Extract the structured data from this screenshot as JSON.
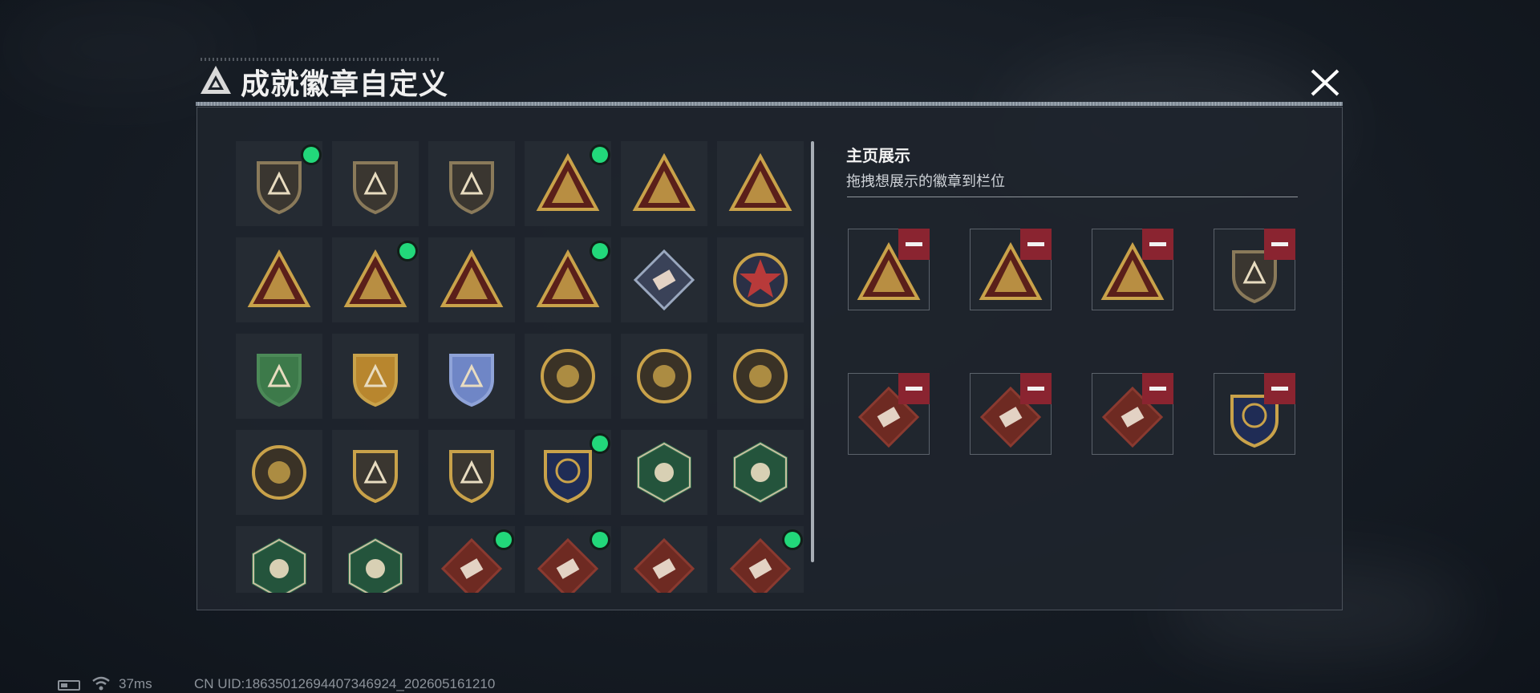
{
  "header": {
    "title": "成就徽章自定义",
    "logo_icon": "triangle-logo-icon",
    "close_icon": "close-icon"
  },
  "grid": {
    "rows": [
      [
        {
          "icon": "shield-triangle-badge-icon",
          "color": "#8a7a5a",
          "equipped": true
        },
        {
          "icon": "shield-helicopter-badge-icon",
          "color": "#8a7a5a",
          "equipped": false
        },
        {
          "icon": "shield-dagger-badge-icon",
          "color": "#8a7a5a",
          "equipped": false
        },
        {
          "icon": "triangle-sign-badge-icon",
          "color": "#c9a24a",
          "equipped": true
        },
        {
          "icon": "triangle-helmet-badge-icon",
          "color": "#c9a24a",
          "equipped": false
        },
        {
          "icon": "triangle-tank-badge-icon",
          "color": "#c9a24a",
          "equipped": false
        }
      ],
      [
        {
          "icon": "triangle-number-badge-icon",
          "color": "#c9a24a",
          "equipped": false
        },
        {
          "icon": "triangle-soldier-badge-icon",
          "color": "#c9a24a",
          "equipped": true
        },
        {
          "icon": "triangle-squad-badge-icon",
          "color": "#c9a24a",
          "equipped": false
        },
        {
          "icon": "triangle-rocket-badge-icon",
          "color": "#c9a24a",
          "equipped": true
        },
        {
          "icon": "diamond-launcher-badge-icon",
          "color": "#9aa8bf",
          "equipped": false
        },
        {
          "icon": "star-wreath-badge-icon",
          "color": "#b83a3a",
          "equipped": false
        }
      ],
      [
        {
          "icon": "green-shield-wings-badge-icon",
          "color": "#4c8a58",
          "equipped": false
        },
        {
          "icon": "gold-shield-wings-badge-icon",
          "color": "#c9a24a",
          "equipped": false
        },
        {
          "icon": "blue-shield-gem-badge-icon",
          "color": "#8fa3d8",
          "equipped": false
        },
        {
          "icon": "round-circle-badge-icon",
          "color": "#c9a24a",
          "equipped": false
        },
        {
          "icon": "round-target-badge-icon",
          "color": "#c9a24a",
          "equipped": false
        },
        {
          "icon": "round-skull-badge-icon",
          "color": "#c9a24a",
          "equipped": false
        }
      ],
      [
        {
          "icon": "round-burst-badge-icon",
          "color": "#c9a24a",
          "equipped": false
        },
        {
          "icon": "shield-rifle-badge-icon",
          "color": "#c9a24a",
          "equipped": false
        },
        {
          "icon": "shield-rifle-badge-icon",
          "color": "#c9a24a",
          "equipped": false
        },
        {
          "icon": "crest-navy-badge-icon",
          "color": "#c9a24a",
          "equipped": true
        },
        {
          "icon": "hex-wasp-badge-icon",
          "color": "#2f6b4a",
          "equipped": false
        },
        {
          "icon": "hex-wasp-badge-icon",
          "color": "#2f6b4a",
          "equipped": false
        }
      ],
      [
        {
          "icon": "hex-fist-badge-icon",
          "color": "#2f6b4a",
          "equipped": false
        },
        {
          "icon": "hex-soldier-badge-icon",
          "color": "#2f6b4a",
          "equipped": false
        },
        {
          "icon": "diamond-dragon-badge-icon",
          "color": "#8a3a30",
          "equipped": true
        },
        {
          "icon": "diamond-runner-badge-icon",
          "color": "#8a3a30",
          "equipped": true
        },
        {
          "icon": "diamond-block-badge-icon",
          "color": "#8a3a30",
          "equipped": false
        },
        {
          "icon": "diamond-cross-badge-icon",
          "color": "#8a3a30",
          "equipped": true
        }
      ]
    ]
  },
  "showcase": {
    "title": "主页展示",
    "subtitle": "拖拽想展示的徽章到栏位",
    "slots": [
      {
        "icon": "triangle-sign-badge-icon",
        "color": "#c9a24a"
      },
      {
        "icon": "triangle-rocket-badge-icon",
        "color": "#c9a24a"
      },
      {
        "icon": "triangle-soldier-badge-icon",
        "color": "#c9a24a"
      },
      {
        "icon": "shield-triangle-badge-icon",
        "color": "#8a7a5a"
      },
      {
        "icon": "diamond-runner-badge-icon",
        "color": "#8a3a30"
      },
      {
        "icon": "diamond-dragon-badge-icon",
        "color": "#8a3a30"
      },
      {
        "icon": "diamond-cross-badge-icon",
        "color": "#8a3a30"
      },
      {
        "icon": "crest-navy-badge-icon",
        "color": "#c9a24a"
      }
    ]
  },
  "status": {
    "ping": "37ms",
    "uid": "CN UID:186350126944073469​24_202605161210"
  }
}
